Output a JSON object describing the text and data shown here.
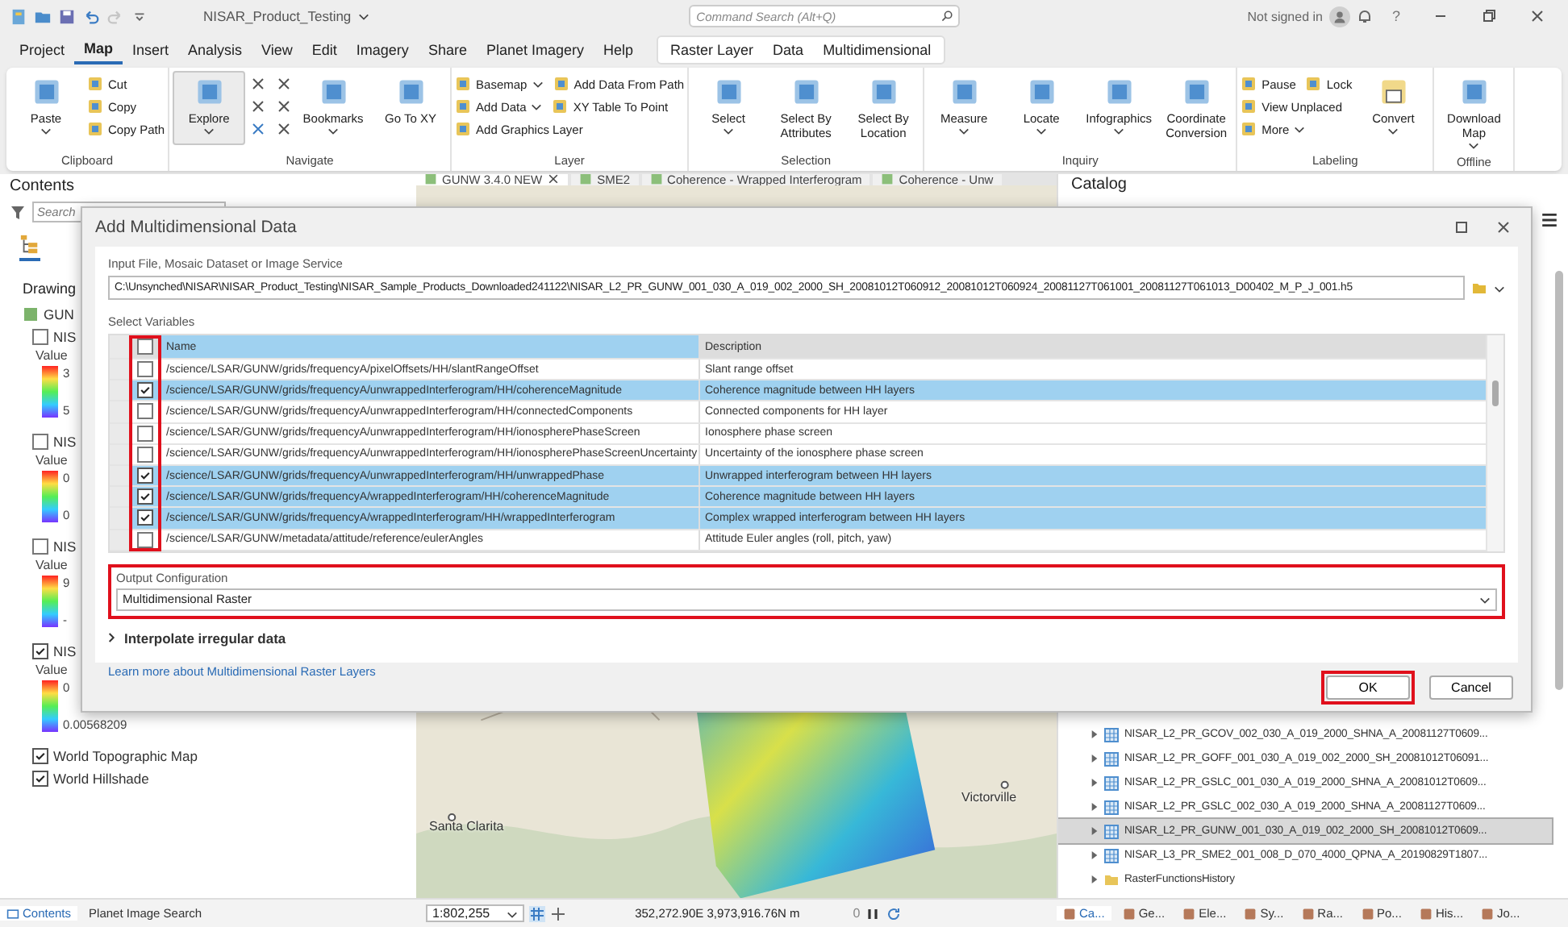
{
  "title_bar": {
    "project": "NISAR_Product_Testing",
    "search_placeholder": "Command Search (Alt+Q)",
    "account": "Not signed in",
    "help": "?"
  },
  "tabs": [
    {
      "label": "Project",
      "selected": false
    },
    {
      "label": "Map",
      "selected": true
    },
    {
      "label": "Insert",
      "selected": false
    },
    {
      "label": "Analysis",
      "selected": false
    },
    {
      "label": "View",
      "selected": false
    },
    {
      "label": "Edit",
      "selected": false
    },
    {
      "label": "Imagery",
      "selected": false
    },
    {
      "label": "Share",
      "selected": false
    },
    {
      "label": "Planet Imagery",
      "selected": false
    },
    {
      "label": "Help",
      "selected": false
    }
  ],
  "contextual_tabs": [
    {
      "label": "Raster Layer",
      "selected": false
    },
    {
      "label": "Data",
      "selected": false
    },
    {
      "label": "Multidimensional",
      "selected": false
    }
  ],
  "ribbon": [
    {
      "label": "Clipboard",
      "kind": "standard",
      "large": [
        {
          "label": "Paste",
          "dropdown": true,
          "selected": false
        }
      ],
      "small": [
        [
          {
            "label": "Cut",
            "dropdown": false
          }
        ],
        [
          {
            "label": "Copy",
            "dropdown": false
          }
        ],
        [
          {
            "label": "Copy Path",
            "dropdown": false
          }
        ]
      ]
    },
    {
      "label": "Navigate",
      "kind": "navigate",
      "large": [
        {
          "label": "Explore",
          "dropdown": true,
          "selected": true
        },
        {
          "label": "Bookmarks",
          "dropdown": true,
          "selected": false
        },
        {
          "label": "Go To XY",
          "dropdown": false,
          "selected": false
        }
      ]
    },
    {
      "label": "Layer",
      "kind": "standard",
      "small": [
        [
          {
            "label": "Basemap",
            "dropdown": true
          },
          {
            "label": "Add Data From Path",
            "dropdown": false
          }
        ],
        [
          {
            "label": "Add Data",
            "dropdown": true
          },
          {
            "label": "XY Table To Point",
            "dropdown": false
          }
        ],
        [
          {
            "label": "Add Graphics Layer",
            "dropdown": false
          }
        ]
      ]
    },
    {
      "label": "Selection",
      "kind": "standard",
      "large": [
        {
          "label": "Select",
          "dropdown": true,
          "selected": false
        },
        {
          "label": "Select By Attributes",
          "dropdown": false,
          "selected": false
        },
        {
          "label": "Select By Location",
          "dropdown": false,
          "selected": false
        }
      ]
    },
    {
      "label": "Inquiry",
      "kind": "standard",
      "large": [
        {
          "label": "Measure",
          "dropdown": true,
          "selected": false
        },
        {
          "label": "Locate",
          "dropdown": true,
          "selected": false
        },
        {
          "label": "Infographics",
          "dropdown": true,
          "selected": false
        },
        {
          "label": "Coordinate Conversion",
          "dropdown": false,
          "selected": false
        }
      ]
    },
    {
      "label": "Labeling",
      "kind": "standard",
      "small": [
        [
          {
            "label": "Pause",
            "dropdown": false
          },
          {
            "label": "Lock",
            "dropdown": false
          }
        ],
        [
          {
            "label": "View Unplaced",
            "dropdown": false
          }
        ],
        [
          {
            "label": "More",
            "dropdown": true
          }
        ]
      ],
      "large_after": [
        {
          "label": "Convert",
          "dropdown": true,
          "selected": false
        }
      ]
    },
    {
      "label": "Offline",
      "kind": "standard",
      "large": [
        {
          "label": "Download Map",
          "dropdown": true,
          "selected": false
        }
      ]
    }
  ],
  "contents": {
    "title": "Contents",
    "search_placeholder": "Search",
    "drawing": "Drawing",
    "group": "GUN",
    "layers": [
      {
        "label": "NIS",
        "checked": false,
        "legend_title": "Value",
        "high": "3",
        "low": "5"
      },
      {
        "label": "NIS",
        "checked": false,
        "legend_title": "Value",
        "high": "0",
        "low": "0"
      },
      {
        "label": "NIS",
        "checked": false,
        "legend_title": "Value",
        "high": "9",
        "low": "-"
      },
      {
        "label": "NIS",
        "checked": true,
        "legend_title": "Value",
        "high": "0",
        "low": "0.00568209"
      }
    ],
    "basemaps": [
      {
        "label": "World Topographic Map",
        "checked": true
      },
      {
        "label": "World Hillshade",
        "checked": true
      }
    ],
    "bottom_tabs": [
      {
        "label": "Contents",
        "selected": true
      },
      {
        "label": "Planet Image Search",
        "selected": false
      }
    ]
  },
  "map": {
    "tabs": [
      {
        "label": "GUNW 3.4.0 NEW",
        "selected": true,
        "closable": true
      },
      {
        "label": "SME2",
        "selected": false,
        "closable": false
      },
      {
        "label": "Coherence - Wrapped Interferogram",
        "selected": false,
        "closable": false
      },
      {
        "label": "Coherence - Unw",
        "selected": false,
        "closable": false
      }
    ],
    "places": [
      "Santa Clarita",
      "Victorville"
    ],
    "scale": "1:802,255",
    "coordinates": "352,272.90E 3,973,916.76N m",
    "selected_count": "0"
  },
  "catalog": {
    "title": "Catalog",
    "items": [
      {
        "label": "NISAR_L2_PR_GCOV_002_030_A_019_2000_SHNA_A_20081127T0609...",
        "kind": "raster",
        "selected": false
      },
      {
        "label": "NISAR_L2_PR_GOFF_001_030_A_019_002_2000_SH_20081012T06091...",
        "kind": "raster",
        "selected": false
      },
      {
        "label": "NISAR_L2_PR_GSLC_001_030_A_019_2000_SHNA_A_20081012T0609...",
        "kind": "raster",
        "selected": false
      },
      {
        "label": "NISAR_L2_PR_GSLC_002_030_A_019_2000_SHNA_A_20081127T0609...",
        "kind": "raster",
        "selected": false
      },
      {
        "label": "NISAR_L2_PR_GUNW_001_030_A_019_002_2000_SH_20081012T0609...",
        "kind": "raster",
        "selected": true
      },
      {
        "label": "NISAR_L3_PR_SME2_001_008_D_070_4000_QPNA_A_20190829T1807...",
        "kind": "raster",
        "selected": false
      },
      {
        "label": "RasterFunctionsHistory",
        "kind": "folder",
        "selected": false
      }
    ],
    "bottom_tabs": [
      {
        "label": "Ca...",
        "selected": true
      },
      {
        "label": "Ge...",
        "selected": false
      },
      {
        "label": "Ele...",
        "selected": false
      },
      {
        "label": "Sy...",
        "selected": false
      },
      {
        "label": "Ra...",
        "selected": false
      },
      {
        "label": "Po...",
        "selected": false
      },
      {
        "label": "His...",
        "selected": false
      },
      {
        "label": "Jo...",
        "selected": false
      }
    ]
  },
  "dialog": {
    "title": "Add Multidimensional Data",
    "input_label": "Input File, Mosaic Dataset or Image Service",
    "input_value": "C:\\Unsynched\\NISAR\\NISAR_Product_Testing\\NISAR_Sample_Products_Downloaded241122\\NISAR_L2_PR_GUNW_001_030_A_019_002_2000_SH_20081012T060912_20081012T060924_20081127T061001_20081127T061013_D00402_M_P_J_001.h5",
    "variables_label": "Select Variables",
    "columns": [
      "Name",
      "Description"
    ],
    "header_checked": false,
    "checkbox_column_highlighted": true,
    "rows": [
      {
        "name": "/science/LSAR/GUNW/grids/frequencyA/pixelOffsets/HH/slantRangeOffset",
        "description": "Slant range offset",
        "checked": false
      },
      {
        "name": "/science/LSAR/GUNW/grids/frequencyA/unwrappedInterferogram/HH/coherenceMagnitude",
        "description": "Coherence magnitude between HH layers",
        "checked": true
      },
      {
        "name": "/science/LSAR/GUNW/grids/frequencyA/unwrappedInterferogram/HH/connectedComponents",
        "description": "Connected components for HH layer",
        "checked": false
      },
      {
        "name": "/science/LSAR/GUNW/grids/frequencyA/unwrappedInterferogram/HH/ionospherePhaseScreen",
        "description": "Ionosphere phase screen",
        "checked": false
      },
      {
        "name": "/science/LSAR/GUNW/grids/frequencyA/unwrappedInterferogram/HH/ionospherePhaseScreenUncertainty",
        "description": "Uncertainty of the ionosphere phase screen",
        "checked": false
      },
      {
        "name": "/science/LSAR/GUNW/grids/frequencyA/unwrappedInterferogram/HH/unwrappedPhase",
        "description": "Unwrapped interferogram between HH layers",
        "checked": true
      },
      {
        "name": "/science/LSAR/GUNW/grids/frequencyA/wrappedInterferogram/HH/coherenceMagnitude",
        "description": "Coherence magnitude between HH layers",
        "checked": true
      },
      {
        "name": "/science/LSAR/GUNW/grids/frequencyA/wrappedInterferogram/HH/wrappedInterferogram",
        "description": "Complex wrapped interferogram between HH layers",
        "checked": true
      },
      {
        "name": "/science/LSAR/GUNW/metadata/attitude/reference/eulerAngles",
        "description": "Attitude Euler angles (roll, pitch, yaw)",
        "checked": false
      }
    ],
    "output_label": "Output Configuration",
    "output_value": "Multidimensional Raster",
    "output_highlighted": true,
    "expander": {
      "label": "Interpolate irregular data",
      "expanded": false
    },
    "link": "Learn more about Multidimensional Raster Layers",
    "buttons": [
      {
        "label": "OK",
        "highlighted": true
      },
      {
        "label": "Cancel",
        "highlighted": false
      }
    ]
  }
}
